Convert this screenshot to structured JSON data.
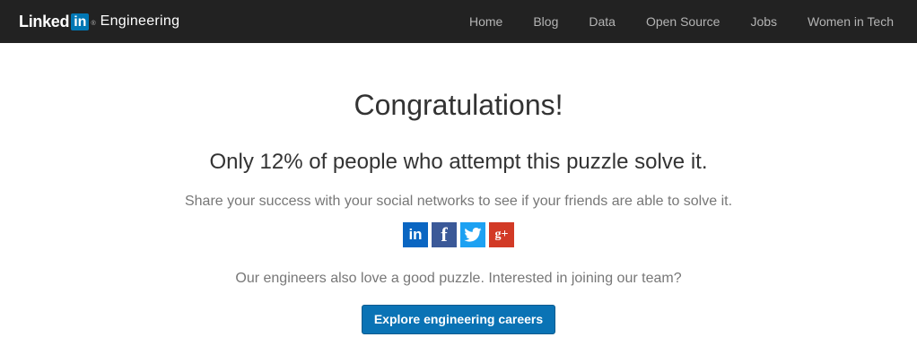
{
  "header": {
    "brand_word": "Linked",
    "brand_in": "in",
    "brand_reg": "®",
    "brand_sub": "Engineering",
    "nav": [
      "Home",
      "Blog",
      "Data",
      "Open Source",
      "Jobs",
      "Women in Tech"
    ]
  },
  "main": {
    "headline": "Congratulations!",
    "subhead": "Only 12% of people who attempt this puzzle solve it.",
    "share_text": "Share your success with your social networks to see if your friends are able to solve it.",
    "social": [
      {
        "icon": "linkedin-icon",
        "glyph": "in"
      },
      {
        "icon": "facebook-icon",
        "glyph": "f"
      },
      {
        "icon": "twitter-icon",
        "glyph": ""
      },
      {
        "icon": "google-plus-icon",
        "glyph": "g+"
      }
    ],
    "team_text": "Our engineers also love a good puzzle. Interested in joining our team?",
    "cta_label": "Explore engineering careers"
  },
  "colors": {
    "topbar": "#222222",
    "brand_blue": "#0077b5",
    "cta_blue": "#0a73b5"
  }
}
